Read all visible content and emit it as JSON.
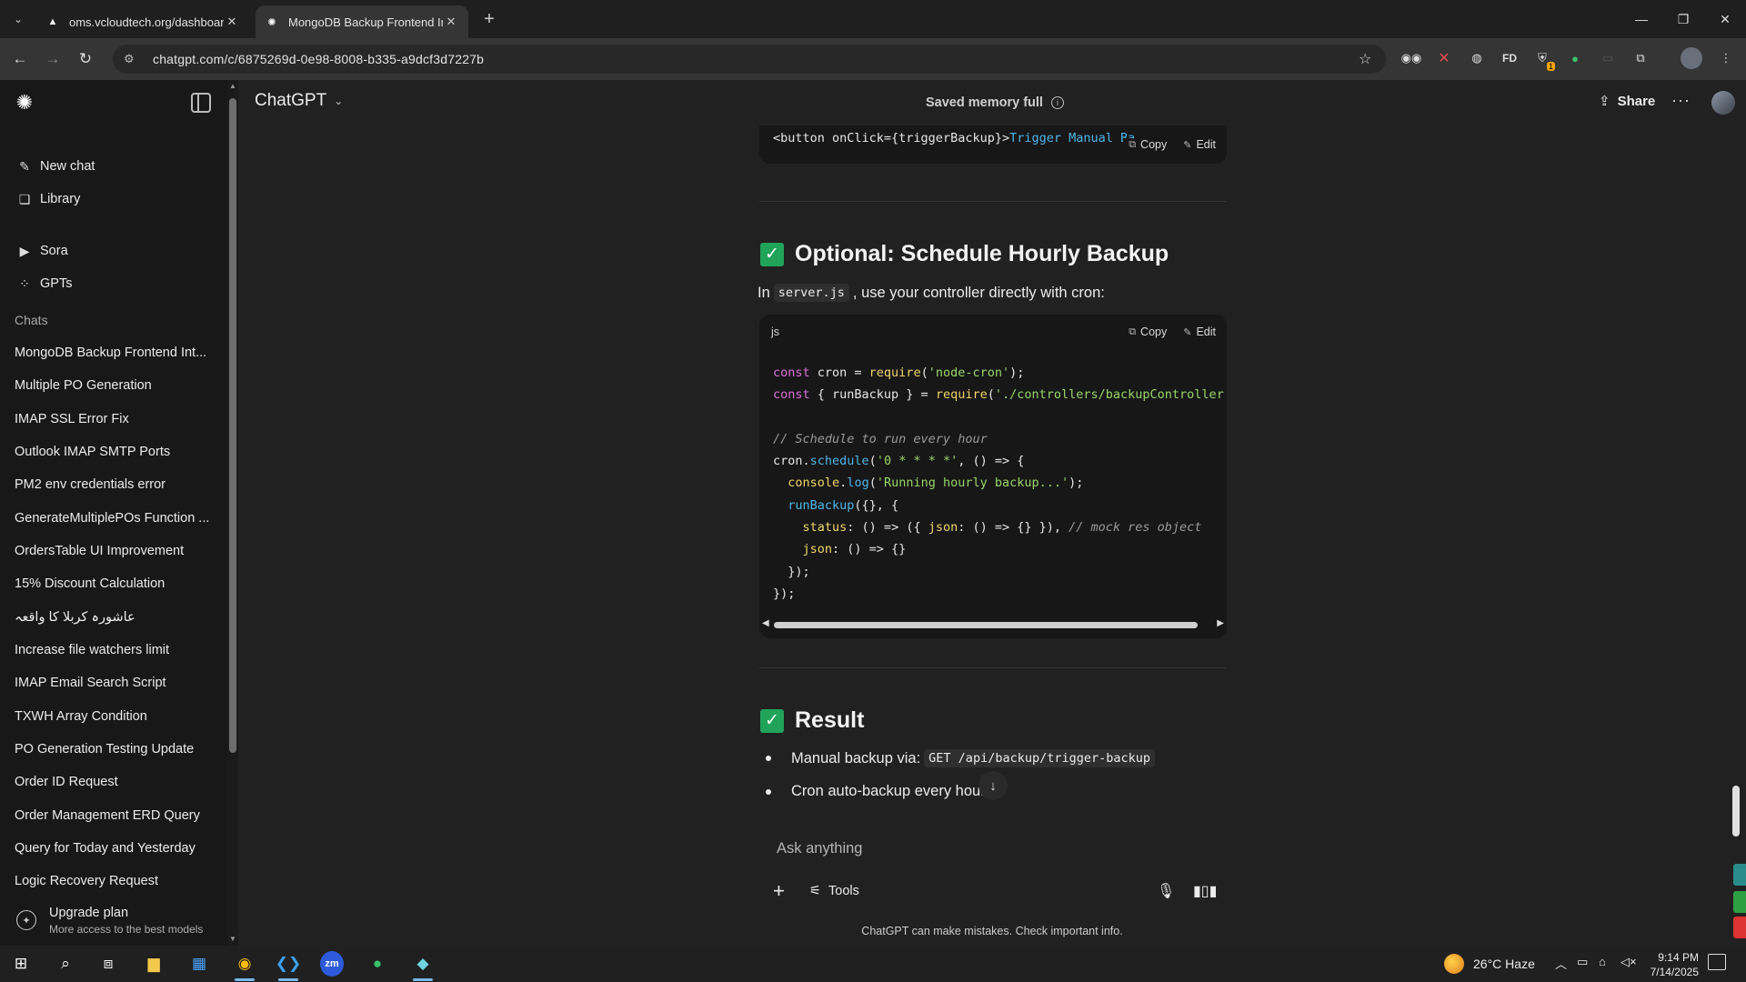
{
  "browser": {
    "tabs": [
      {
        "title": "oms.vcloudtech.org/dashboard",
        "icon": "triangle-icon"
      },
      {
        "title": "MongoDB Backup Frontend Int",
        "icon": "openai-icon"
      }
    ],
    "url": "chatgpt.com/c/6875269d-0e98-8008-b335-a9dcf3d7227b",
    "extensions": [
      "glasses-icon",
      "x-icon",
      "globe-icon",
      "fd-icon",
      "shield-badge-icon",
      "chatgpt-ext-icon",
      "screen-icon",
      "puzzle-icon"
    ],
    "extension_badge": "1"
  },
  "sidebar": {
    "top_items": [
      {
        "label": "New chat",
        "icon": "edit-icon"
      },
      {
        "label": "Library",
        "icon": "library-icon"
      },
      {
        "label": "Sora",
        "icon": "play-icon"
      },
      {
        "label": "GPTs",
        "icon": "grid-icon"
      }
    ],
    "chats_heading": "Chats",
    "chats": [
      "MongoDB Backup Frontend Int...",
      "Multiple PO Generation",
      "IMAP SSL Error Fix",
      "Outlook IMAP SMTP Ports",
      "PM2 env credentials error",
      "GenerateMultiplePOs Function ...",
      "OrdersTable UI Improvement",
      "15% Discount Calculation",
      "عاشورہ کربلا کا واقعہ",
      "Increase file watchers limit",
      "IMAP Email Search Script",
      "TXWH Array Condition",
      "PO Generation Testing Update",
      "Order ID Request",
      "Order Management ERD Query",
      "Query for Today and Yesterday",
      "Logic Recovery Request"
    ],
    "upgrade": {
      "title": "Upgrade plan",
      "subtitle": "More access to the best models"
    }
  },
  "header": {
    "model": "ChatGPT",
    "memory": "Saved memory full",
    "share": "Share"
  },
  "conversation": {
    "prev_code_line_a": "<button onClick={triggerBackup}>",
    "prev_code_line_b": "Trigger Manual Ba",
    "copy": "Copy",
    "edit": "Edit",
    "section1_title": "Optional: Schedule Hourly Backup",
    "section1_para_pre": "In",
    "section1_para_code": "server.js",
    "section1_para_post": ", use your controller directly with cron:",
    "code_lang": "js",
    "section2_title": "Result",
    "bullet1_text": "Manual backup via:",
    "bullet1_code": "GET /api/backup/trigger-backup",
    "bullet2_text": "Cron auto-backup every hour"
  },
  "composer": {
    "placeholder": "Ask anything",
    "tools": "Tools",
    "disclaimer": "ChatGPT can make mistakes. Check important info."
  },
  "taskbar": {
    "weather": "26°C  Haze",
    "time": "9:14 PM",
    "date": "7/14/2025"
  }
}
